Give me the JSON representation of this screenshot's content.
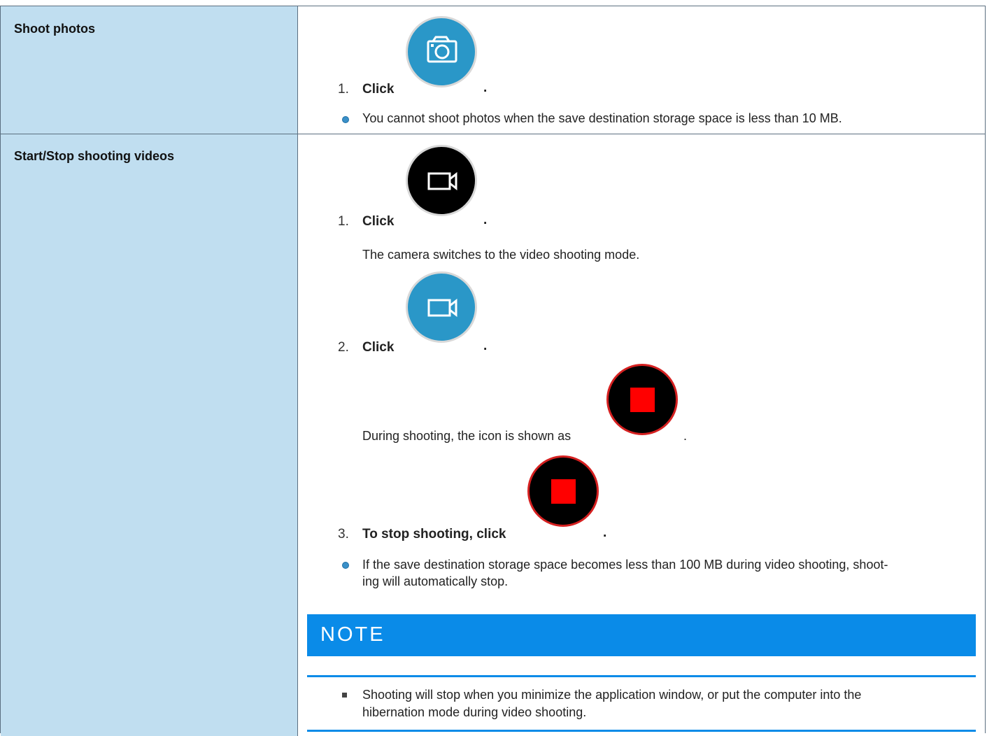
{
  "rows": [
    {
      "label": "Shoot photos",
      "step1_num": "1.",
      "step1_text": "Click",
      "step1_icon": "camera-icon",
      "step1_end": ".",
      "bullet": "You cannot shoot photos when the save destination storage space is less than 10 MB."
    },
    {
      "label": "Start/Stop shooting videos",
      "step1_num": "1.",
      "step1_text": "Click",
      "step1_icon": "video-camera-icon",
      "step1_end": ".",
      "step1_desc": "The camera switches to the video shooting mode.",
      "step2_num": "2.",
      "step2_text": "Click",
      "step2_icon": "video-camera-icon",
      "step2_end": ".",
      "step2_desc": "During shooting, the icon is shown as",
      "step2_desc_end": ".",
      "step2_desc_icon": "stop-icon",
      "step3_num": "3.",
      "step3_text": "To stop shooting, click",
      "step3_icon": "stop-icon",
      "step3_end": ".",
      "bullet_line1": "If the save destination storage space becomes less than 100 MB during video shooting, shoot-",
      "bullet_line2": "ing will automatically stop.",
      "note_title": "NOTE",
      "note_line1": "Shooting will stop when you minimize the application window, or put the computer into the",
      "note_line2": "hibernation mode during video shooting."
    }
  ],
  "colors": {
    "label_bg": "#c0def0",
    "blue_button": "#2a97c8",
    "note_blue": "#0a8be8",
    "stop_red": "#ff0000"
  }
}
